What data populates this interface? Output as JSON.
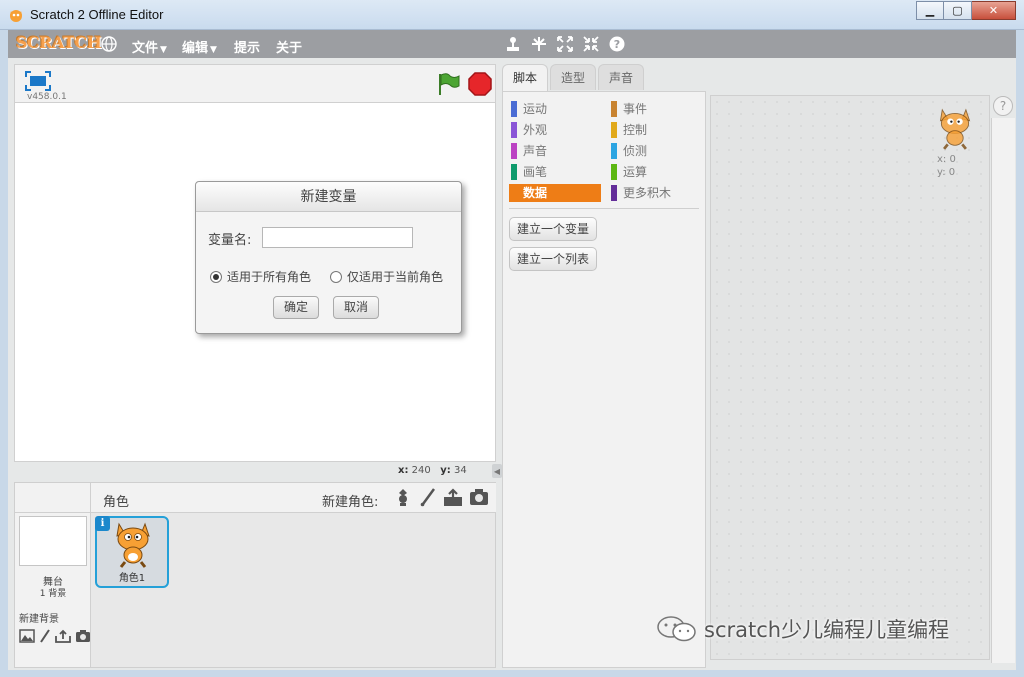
{
  "window": {
    "title": "Scratch 2 Offline Editor",
    "minimize_icon": "minimize-icon",
    "maximize_icon": "maximize-icon",
    "close_icon": "close-icon"
  },
  "menubar": {
    "logo": "SCRATCH",
    "language_icon": "globe-icon",
    "items": [
      {
        "label": "文件",
        "has_dropdown": true
      },
      {
        "label": "编辑",
        "has_dropdown": true
      },
      {
        "label": "提示",
        "has_dropdown": false
      },
      {
        "label": "关于",
        "has_dropdown": false
      }
    ],
    "tools": [
      "duplicate-stamp-icon",
      "cut-icon",
      "grow-icon",
      "shrink-icon",
      "help-icon"
    ],
    "caret": "▼"
  },
  "stage": {
    "version": "v458.0.1",
    "coords": {
      "x_label": "x:",
      "x_value": "240",
      "y_label": "y:",
      "y_value": "34"
    }
  },
  "dialog": {
    "title": "新建变量",
    "name_label": "变量名:",
    "name_value": "",
    "radio_all": "适用于所有角色",
    "radio_current": "仅适用于当前角色",
    "selected": "all",
    "ok": "确定",
    "cancel": "取消"
  },
  "sprites": {
    "header": "角色",
    "new_sprite": "新建角色:",
    "stage_name": "舞台",
    "stage_backdrops": "1 背景",
    "new_backdrop": "新建背景",
    "items": [
      {
        "name": "角色1",
        "selected": true
      }
    ]
  },
  "tabs": [
    {
      "label": "脚本",
      "active": true
    },
    {
      "label": "造型",
      "active": false
    },
    {
      "label": "声音",
      "active": false
    }
  ],
  "categories": [
    {
      "label": "运动",
      "color": "#4a6cd4",
      "col": 0,
      "row": 0
    },
    {
      "label": "外观",
      "color": "#8a55d7",
      "col": 0,
      "row": 1
    },
    {
      "label": "声音",
      "color": "#bb42c3",
      "col": 0,
      "row": 2
    },
    {
      "label": "画笔",
      "color": "#0e9a6c",
      "col": 0,
      "row": 3
    },
    {
      "label": "数据",
      "color": "#ee7d16",
      "col": 0,
      "row": 4,
      "active": true
    },
    {
      "label": "事件",
      "color": "#c88330",
      "col": 1,
      "row": 0
    },
    {
      "label": "控制",
      "color": "#e1a91a",
      "col": 1,
      "row": 1
    },
    {
      "label": "侦测",
      "color": "#2ca5e2",
      "col": 1,
      "row": 2
    },
    {
      "label": "运算",
      "color": "#5cb712",
      "col": 1,
      "row": 3
    },
    {
      "label": "更多积木",
      "color": "#632d99",
      "col": 1,
      "row": 4
    }
  ],
  "palette_buttons": [
    "建立一个变量",
    "建立一个列表"
  ],
  "scripts_area": {
    "sprite_x": "x: 0",
    "sprite_y": "y: 0",
    "help": "?"
  },
  "watermark": "scratch少儿编程儿童编程"
}
